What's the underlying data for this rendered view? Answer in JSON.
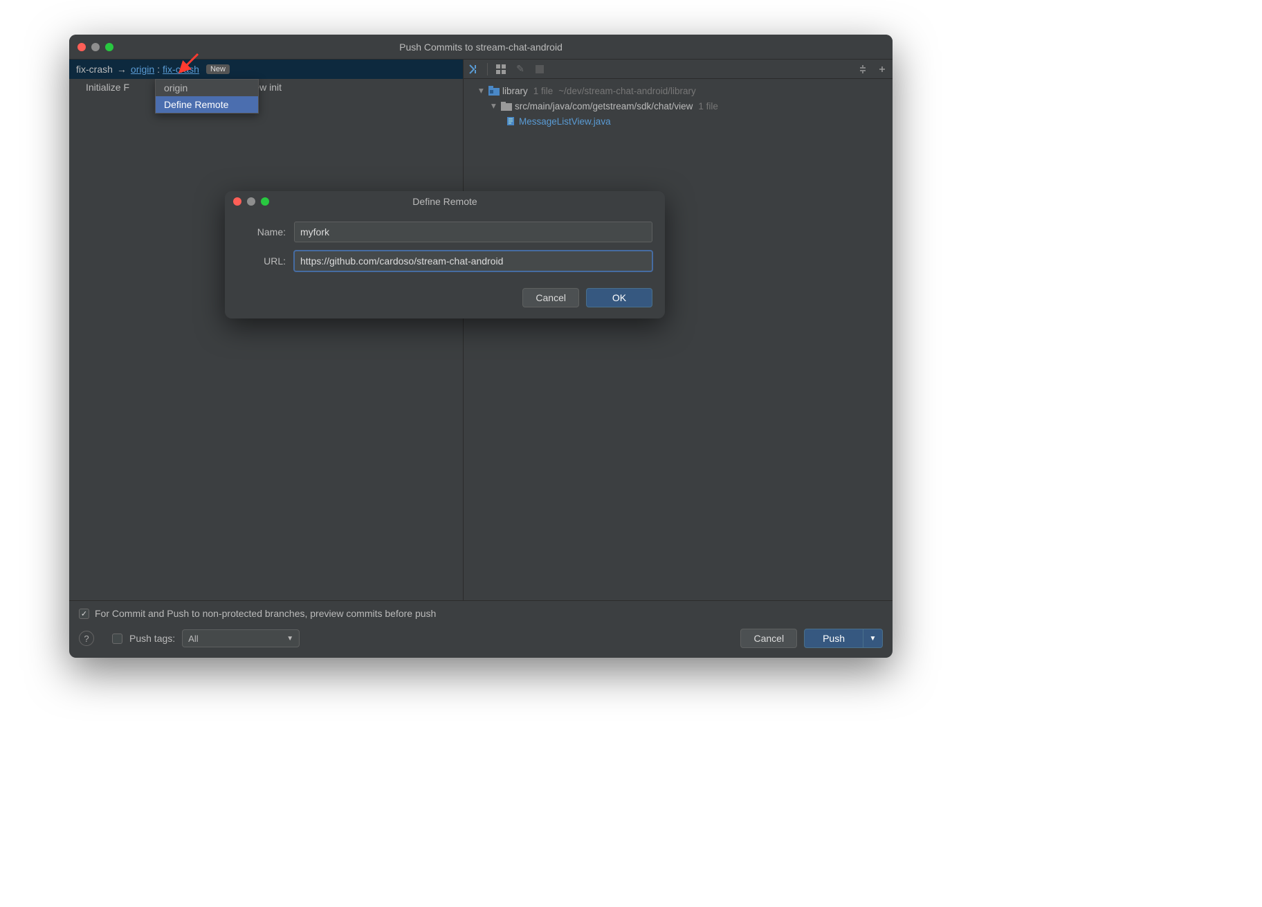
{
  "window": {
    "title": "Push Commits to stream-chat-android"
  },
  "branch_row": {
    "local_branch": "fix-crash",
    "remote": "origin",
    "remote_branch": "fix-crash",
    "new_badge": "New"
  },
  "commit_message_partial_left": "Initialize F",
  "commit_message_partial_right": "eListView init",
  "dropdown": {
    "items": [
      "origin",
      "Define Remote"
    ],
    "selected_index": 1
  },
  "tree": {
    "root_label": "library",
    "root_file_count": "1 file",
    "root_path": "~/dev/stream-chat-android/library",
    "pkg_label": "src/main/java/com/getstream/sdk/chat/view",
    "pkg_file_count": "1 file",
    "file_name": "MessageListView.java"
  },
  "footer": {
    "preview_label": "For Commit and Push to non-protected branches, preview commits before push",
    "push_tags_label": "Push tags:",
    "push_tags_value": "All",
    "cancel": "Cancel",
    "push": "Push"
  },
  "modal": {
    "title": "Define Remote",
    "name_label": "Name:",
    "name_value": "myfork",
    "url_label": "URL:",
    "url_value": "https://github.com/cardoso/stream-chat-android",
    "cancel": "Cancel",
    "ok": "OK"
  }
}
